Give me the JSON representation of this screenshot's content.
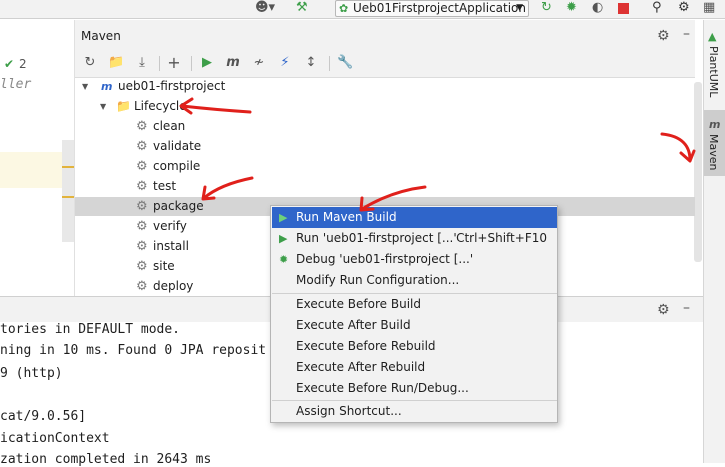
{
  "topbar": {
    "config_name": "Ueb01FirstprojectApplication",
    "icons": [
      "user-icon",
      "hammer-icon",
      "rerun-icon",
      "debug-icon",
      "coverage-icon",
      "stop-icon",
      "search-icon",
      "settings-icon"
    ]
  },
  "editor": {
    "badge_count": "2",
    "fragment": "ller"
  },
  "maven": {
    "title": "Maven",
    "toolbar_icons": [
      "reload-icon",
      "add-project-icon",
      "download-icon",
      "plus-icon",
      "run-icon",
      "maven-goal-icon",
      "skip-tests-icon",
      "offline-icon",
      "collapse-icon",
      "wrench-icon"
    ],
    "tree": {
      "project": "ueb01-firstproject",
      "lifecycle": "Lifecycle",
      "phases": [
        "clean",
        "validate",
        "compile",
        "test",
        "package",
        "verify",
        "install",
        "site",
        "deploy"
      ],
      "selected": "package"
    }
  },
  "sidebar": {
    "tabs": [
      "PlantUML",
      "Maven"
    ]
  },
  "console": {
    "lines": [
      "tories in DEFAULT mode.",
      "ning in 10 ms. Found 0 JPA reposit",
      "9 (http)",
      "",
      "cat/9.0.56]",
      "icationContext",
      "zation completed in 2643 ms"
    ]
  },
  "context_menu": {
    "items": [
      {
        "label": "Run Maven Build",
        "shortcut": "",
        "icon": "run-icon"
      },
      {
        "label": "Run 'ueb01-firstproject [...'",
        "shortcut": "Ctrl+Shift+F10",
        "icon": "run-icon"
      },
      {
        "label": "Debug 'ueb01-firstproject [...'",
        "shortcut": "",
        "icon": "debug-icon"
      },
      {
        "label": "Modify Run Configuration...",
        "shortcut": "",
        "icon": ""
      },
      {
        "label": "Execute Before Build",
        "shortcut": "",
        "icon": ""
      },
      {
        "label": "Execute After Build",
        "shortcut": "",
        "icon": ""
      },
      {
        "label": "Execute Before Rebuild",
        "shortcut": "",
        "icon": ""
      },
      {
        "label": "Execute After Rebuild",
        "shortcut": "",
        "icon": ""
      },
      {
        "label": "Execute Before Run/Debug...",
        "shortcut": "",
        "icon": ""
      },
      {
        "label": "Assign Shortcut...",
        "shortcut": "",
        "icon": ""
      }
    ]
  },
  "colors": {
    "highlight": "#2f65ca",
    "run_green": "#3d9e49",
    "annotation_red": "#e0201b"
  }
}
